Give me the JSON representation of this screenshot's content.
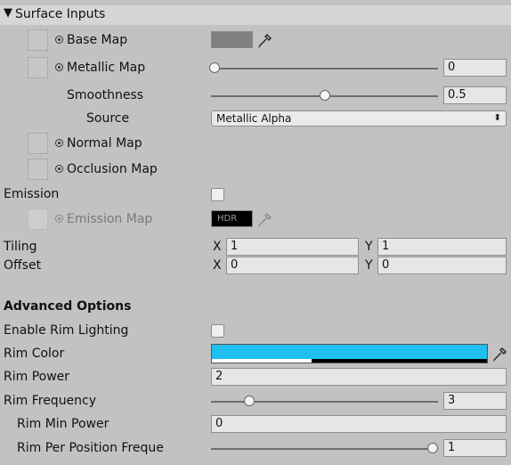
{
  "section": {
    "title": "Surface Inputs",
    "collapse_glyph": "▼"
  },
  "base_map": {
    "label": "Base Map",
    "swatch_color": "#808080"
  },
  "metallic_map": {
    "label": "Metallic Map",
    "value": "0",
    "slider": 0.0
  },
  "smoothness": {
    "label": "Smoothness",
    "value": "0.5",
    "slider": 0.5
  },
  "source": {
    "label": "Source",
    "selected": "Metallic Alpha",
    "chevron": "⬍"
  },
  "normal_map": {
    "label": "Normal Map"
  },
  "occlusion_map": {
    "label": "Occlusion Map"
  },
  "emission": {
    "label": "Emission",
    "checked": false
  },
  "emission_map": {
    "label": "Emission Map",
    "swatch_text": "HDR",
    "swatch_color": "#000000"
  },
  "tiling": {
    "label": "Tiling",
    "x_label": "X",
    "x": "1",
    "y_label": "Y",
    "y": "1"
  },
  "offset": {
    "label": "Offset",
    "x_label": "X",
    "x": "0",
    "y_label": "Y",
    "y": "0"
  },
  "advanced": {
    "title": "Advanced Options"
  },
  "enable_rim": {
    "label": "Enable Rim Lighting",
    "checked": false
  },
  "rim_color": {
    "label": "Rim Color",
    "color": "#1fbff0"
  },
  "rim_power": {
    "label": "Rim Power",
    "value": "2"
  },
  "rim_frequency": {
    "label": "Rim Frequency",
    "value": "3",
    "slider": 0.2
  },
  "rim_min_power": {
    "label": "Rim Min Power",
    "value": "0"
  },
  "rim_per_position": {
    "label": "Rim Per Position Freque",
    "value": "1",
    "slider": 1.0
  }
}
